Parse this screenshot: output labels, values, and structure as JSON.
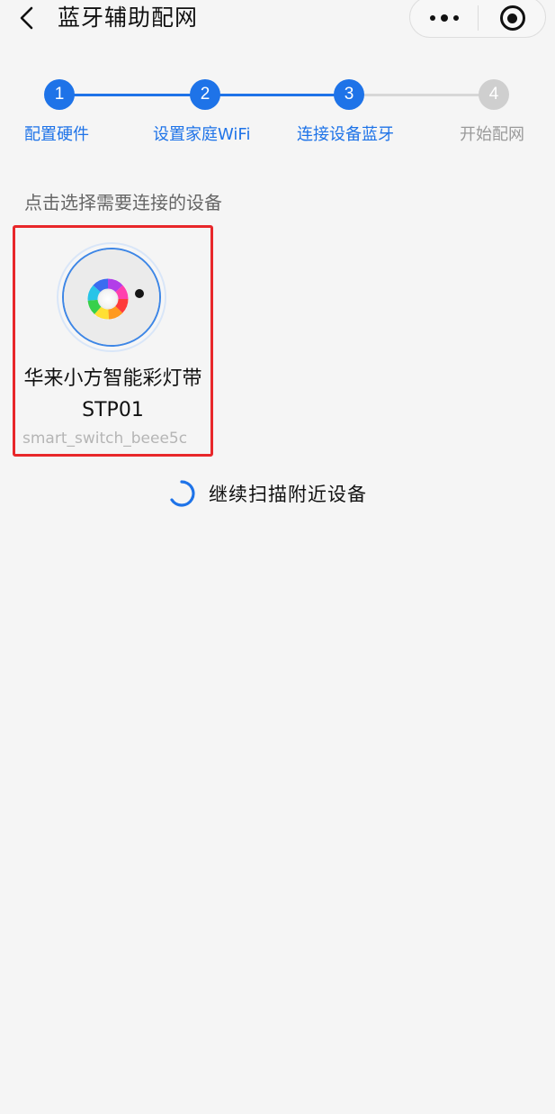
{
  "header": {
    "title": "蓝牙辅助配网",
    "back_icon": "chevron-left-icon",
    "more_icon": "more-dots-icon",
    "close_icon": "target-icon"
  },
  "stepper": {
    "active_color": "#1e73e8",
    "inactive_color": "#cfcfcf",
    "current_step": 3,
    "steps": [
      {
        "number": "1",
        "label": "配置硬件",
        "state": "done"
      },
      {
        "number": "2",
        "label": "设置家庭WiFi",
        "state": "done"
      },
      {
        "number": "3",
        "label": "连接设备蓝牙",
        "state": "current"
      },
      {
        "number": "4",
        "label": "开始配网",
        "state": "pending"
      }
    ]
  },
  "hint": "点击选择需要连接的设备",
  "devices": [
    {
      "name": "华来小方智能彩灯带STP01",
      "id": "smart_switch_beee5c",
      "icon": "rgb-light-strip-icon",
      "highlight_color": "#e8272a"
    }
  ],
  "scan": {
    "label": "继续扫描附近设备",
    "icon": "loading-spinner-icon"
  }
}
